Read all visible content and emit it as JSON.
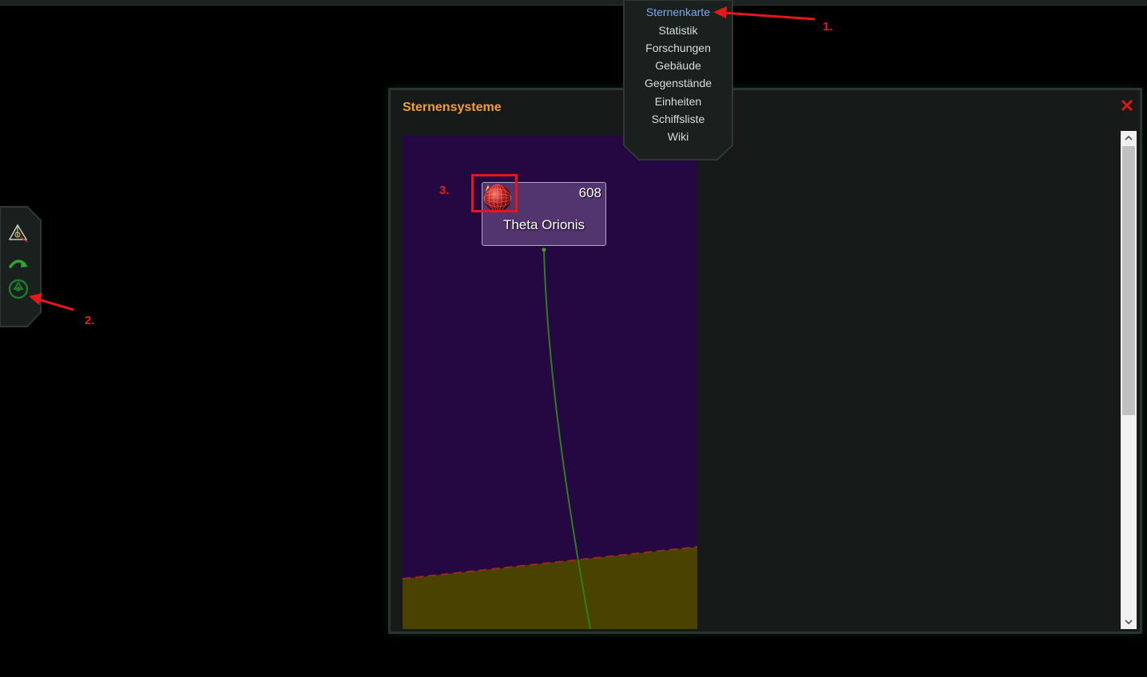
{
  "nav": {
    "items": [
      {
        "label": "Sternenkarte",
        "active": true
      },
      {
        "label": "Statistik",
        "active": false
      },
      {
        "label": "Forschungen",
        "active": false
      },
      {
        "label": "Gebäude",
        "active": false
      },
      {
        "label": "Gegenstände",
        "active": false
      },
      {
        "label": "Einheiten",
        "active": false
      },
      {
        "label": "Schiffsliste",
        "active": false
      },
      {
        "label": "Wiki",
        "active": false
      }
    ],
    "active_color": "#7ea7f0",
    "text_color": "#d7dcd9"
  },
  "dialog": {
    "title": "Sternensysteme",
    "title_color": "#f2a02d",
    "close_icon": "close-icon",
    "system": {
      "name": "Theta Orionis",
      "count": "608"
    },
    "colors": {
      "map_background": "#250842",
      "territory": "#4a4200",
      "border_line": "#9b2a1f",
      "route_line": "#2e7d1e"
    }
  },
  "tools": [
    {
      "icon": "compass-icon"
    },
    {
      "icon": "redo-arrow-icon"
    },
    {
      "icon": "recycle-icon"
    }
  ],
  "annotations": {
    "a1": "1.",
    "a2": "2.",
    "a3": "3.",
    "color": "#e0211c"
  }
}
